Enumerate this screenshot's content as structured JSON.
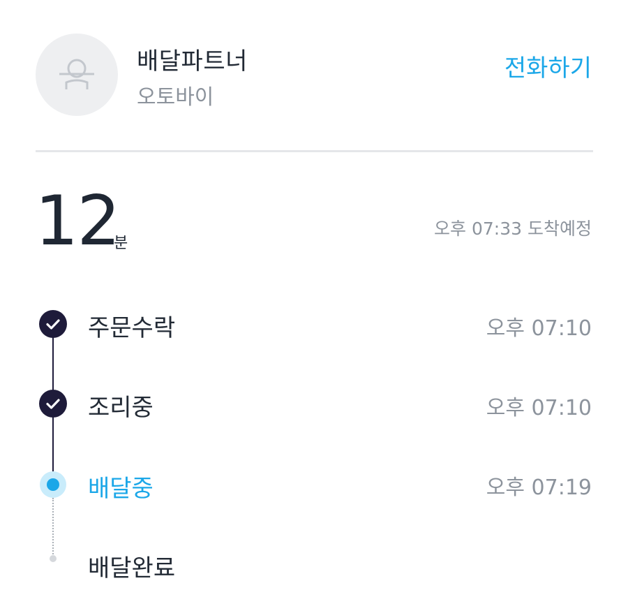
{
  "rider": {
    "name": "배달파트너",
    "vehicle": "오토바이",
    "call_label": "전화하기",
    "avatar_icon": "person-icon"
  },
  "eta": {
    "minutes": "12",
    "unit": "분",
    "arrival": "오후 07:33 도착예정"
  },
  "steps": [
    {
      "label": "주문수락",
      "time": "오후 07:10",
      "status": "done",
      "icon": "check-icon"
    },
    {
      "label": "조리중",
      "time": "오후 07:10",
      "status": "done",
      "icon": "check-icon"
    },
    {
      "label": "배달중",
      "time": "오후 07:19",
      "status": "active"
    },
    {
      "label": "배달완료",
      "time": "",
      "status": "pending"
    }
  ],
  "colors": {
    "accent": "#1ba7e8",
    "done": "#1e1b3a",
    "muted": "#8c939c",
    "text": "#222a35"
  }
}
